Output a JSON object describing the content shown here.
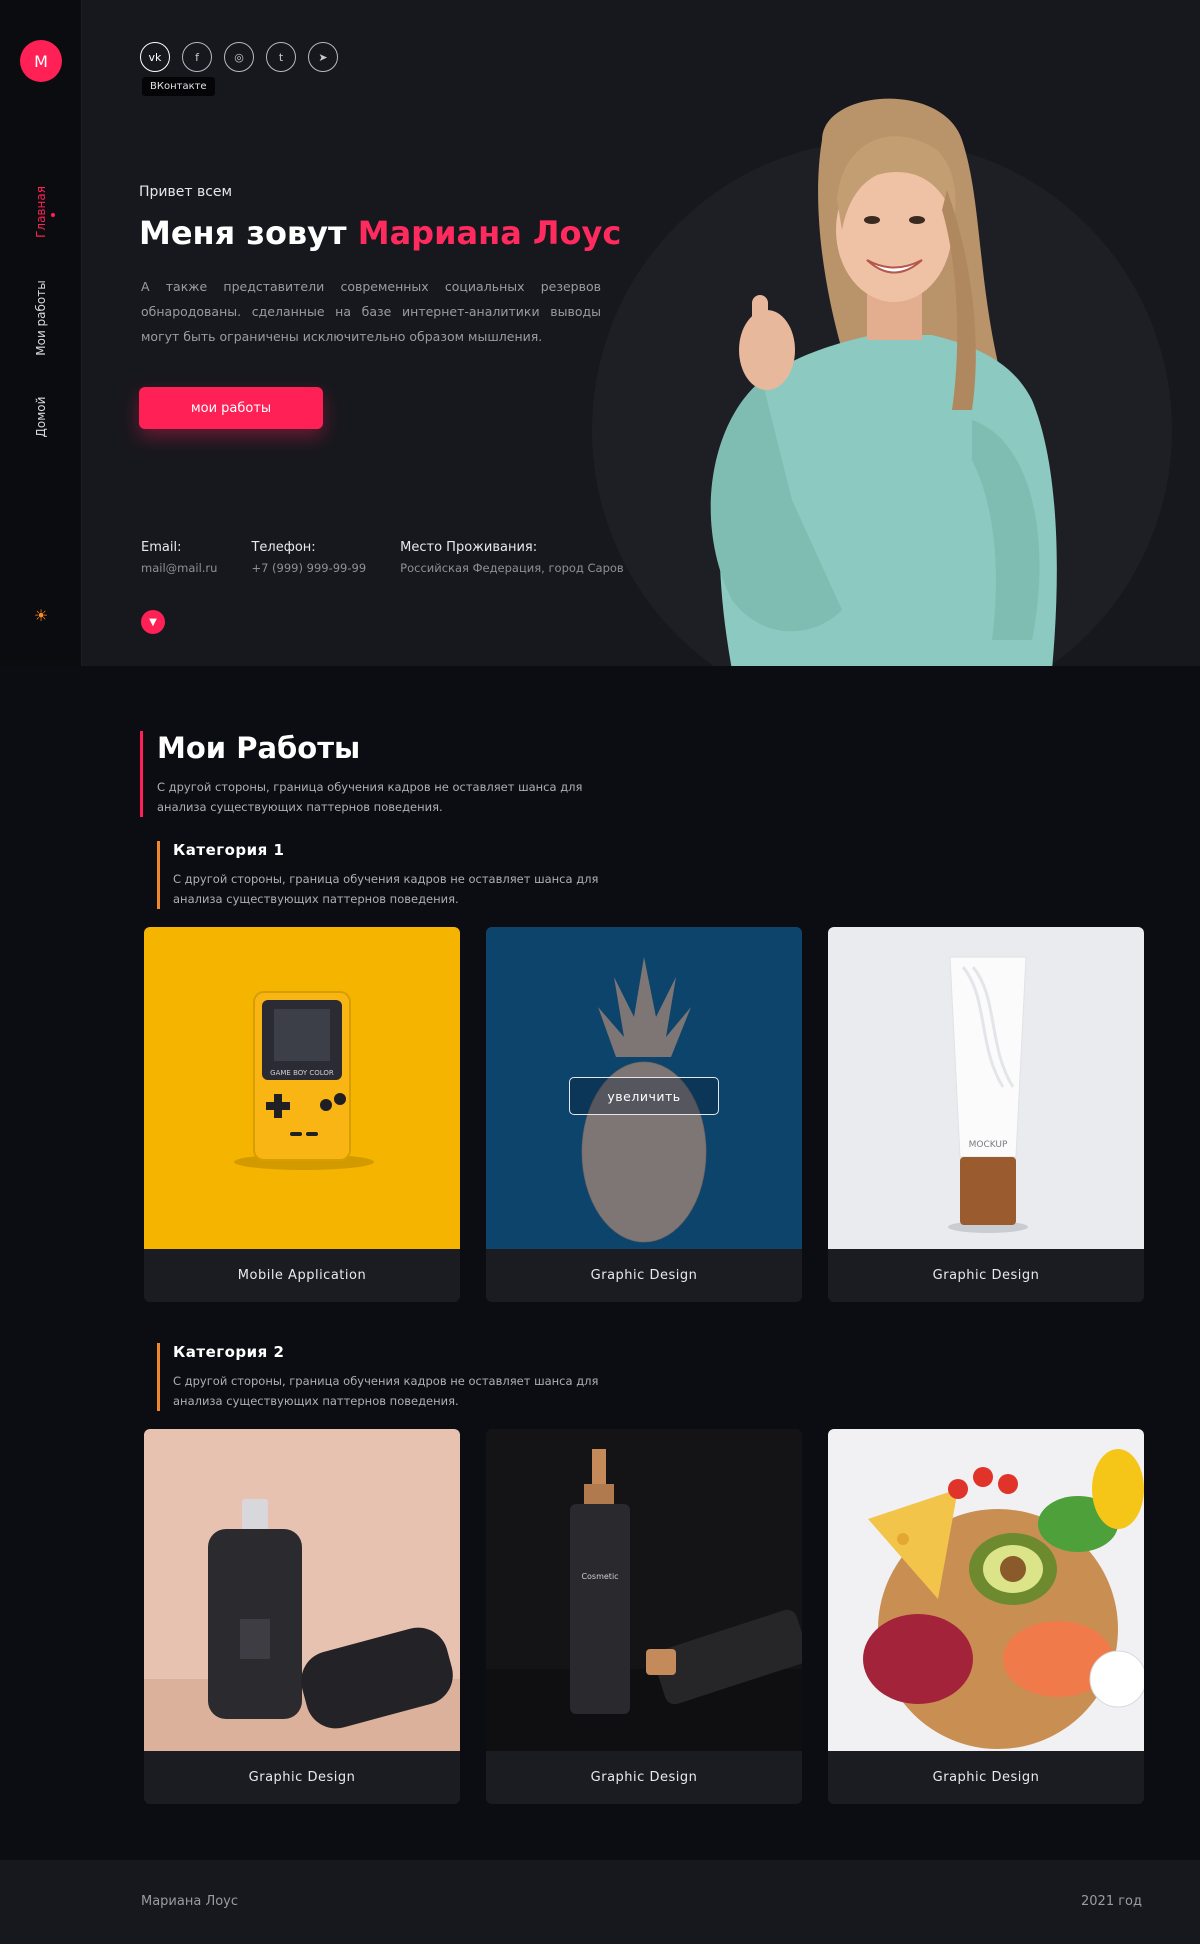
{
  "brand": {
    "logo_letter": "M"
  },
  "sidebar": {
    "items": [
      {
        "label": "Главная",
        "active": true
      },
      {
        "label": "Мои работы",
        "active": false
      },
      {
        "label": "Домой",
        "active": false
      }
    ],
    "theme_icon": "sun-icon"
  },
  "hero": {
    "socials": [
      {
        "icon": "vk-icon",
        "glyph": "vk"
      },
      {
        "icon": "facebook-icon",
        "glyph": "f"
      },
      {
        "icon": "instagram-icon",
        "glyph": "◎"
      },
      {
        "icon": "twitter-icon",
        "glyph": "t"
      },
      {
        "icon": "telegram-icon",
        "glyph": "➤"
      }
    ],
    "tooltip": "ВКонтакте",
    "greeting": "Привет всем",
    "title_prefix": "Меня зовут",
    "title_name": "Мариана Лоус",
    "lead": "А также представители современных социальных резервов обнародованы. сделанные на базе интернет-аналитики выводы могут быть ограничены исключительно образом мышления.",
    "button": "мои работы",
    "contacts": [
      {
        "label": "Email:",
        "value": "mail@mail.ru"
      },
      {
        "label": "Телефон:",
        "value": "+7 (999) 999-99-99"
      },
      {
        "label": "Место Проживания:",
        "value": "Российская Федерация, город Саров"
      }
    ]
  },
  "works": {
    "title": "Мои Работы",
    "desc": "С другой стороны, граница обучения кадров не оставляет шанса для анализа существующих паттернов поведения.",
    "categories": [
      {
        "title": "Категория 1",
        "desc": "С другой стороны, граница обучения кадров не оставляет шанса для анализа существующих паттернов поведения.",
        "cards": [
          {
            "label": "Mobile Application"
          },
          {
            "label": "Graphic Design",
            "zoom": "увеличить"
          },
          {
            "label": "Graphic Design"
          }
        ]
      },
      {
        "title": "Категория 2",
        "desc": "С другой стороны, граница обучения кадров не оставляет шанса для анализа существующих паттернов поведения.",
        "cards": [
          {
            "label": "Graphic Design"
          },
          {
            "label": "Graphic Design"
          },
          {
            "label": "Graphic Design"
          }
        ]
      }
    ]
  },
  "footer": {
    "name": "Мариана Лоус",
    "year": "2021 год"
  },
  "colors": {
    "accent": "#ff2056",
    "category_accent": "#f0872d",
    "background": "#0c0d12",
    "hero_background": "#17181e"
  }
}
